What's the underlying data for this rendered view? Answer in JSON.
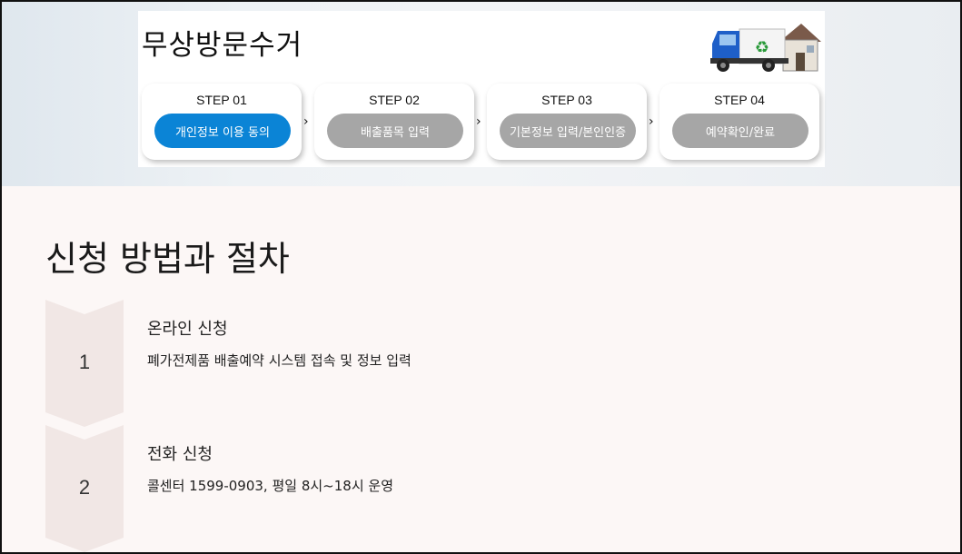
{
  "banner": {
    "title": "무상방문수거",
    "steps": [
      {
        "label": "STEP 01",
        "button": "개인정보 이용 동의",
        "active": true
      },
      {
        "label": "STEP 02",
        "button": "배출품목 입력",
        "active": false
      },
      {
        "label": "STEP 03",
        "button": "기본정보 입력/본인인증",
        "active": false
      },
      {
        "label": "STEP 04",
        "button": "예약확인/완료",
        "active": false
      }
    ],
    "separator": "›"
  },
  "section": {
    "title": "신청 방법과 절차",
    "procedures": [
      {
        "number": "1",
        "title": "온라인 신청",
        "description": "폐가전제품 배출예약 시스템 접속 및 정보 입력"
      },
      {
        "number": "2",
        "title": "전화 신청",
        "description": "콜센터 1599-0903, 평일 8시~18시 운영"
      }
    ]
  },
  "colors": {
    "active_step": "#0b84d6",
    "inactive_step": "#a6a6a6",
    "chevron_block": "#f1e7e5",
    "page_bg": "#fcf7f6"
  }
}
